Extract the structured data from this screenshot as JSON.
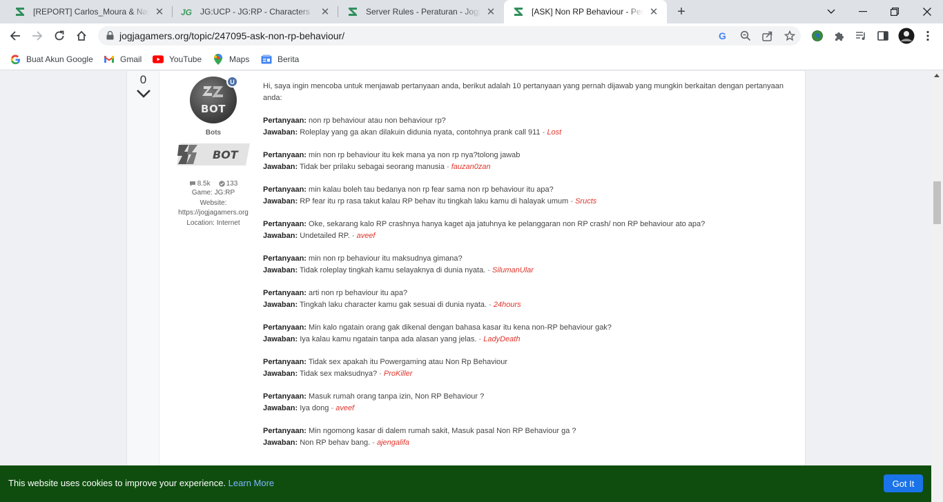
{
  "tabs": [
    {
      "title": "[REPORT] Carlos_Moura & Nayla_",
      "favicon": "jg-logo-icon",
      "active": false
    },
    {
      "title": "JG:UCP - JG:RP - Characters",
      "favicon": "jg-italic-icon",
      "active": false
    },
    {
      "title": "Server Rules - Peraturan - Jogjag",
      "favicon": "jg-logo-icon",
      "active": false
    },
    {
      "title": "[ASK] Non RP Behaviour - Pertan",
      "favicon": "jg-logo-icon",
      "active": true
    }
  ],
  "toolbar": {
    "url": "jogjagamers.org/topic/247095-ask-non-rp-behaviour/"
  },
  "bookmarks": [
    {
      "label": "Buat Akun Google",
      "icon": "google-icon"
    },
    {
      "label": "Gmail",
      "icon": "gmail-icon"
    },
    {
      "label": "YouTube",
      "icon": "youtube-icon"
    },
    {
      "label": "Maps",
      "icon": "maps-icon"
    },
    {
      "label": "Berita",
      "icon": "news-icon"
    }
  ],
  "post": {
    "vote_count": "0",
    "author": {
      "avatar_text": "BOT",
      "badge_letter": "U",
      "group": "Bots",
      "group_badge_text": "BOT",
      "posts": "8.5k",
      "reputation": "133",
      "game": "Game: JG:RP",
      "website_label": "Website:",
      "website": "https://jogjagamers.org",
      "location": "Location: Internet"
    },
    "intro": "Hi, saya ingin mencoba untuk menjawab pertanyaan anda, berikut adalah 10 pertanyaan yang pernah dijawab yang mungkin berkaitan dengan pertanyaan anda:",
    "q_label": "Pertanyaan:",
    "a_label": "Jawaban:",
    "qa": [
      {
        "q": "non rp behaviour atau non behaviour rp?",
        "a": "Roleplay yang ga akan dilakuin didunia nyata, contohnya prank call 911",
        "by": "Lost"
      },
      {
        "q": "min non rp behaviour itu kek mana ya non rp nya?tolong jawab",
        "a": "Tidak ber prilaku sebagai seorang manusia",
        "by": "fauzan0zan"
      },
      {
        "q": "min kalau boleh tau bedanya non rp fear sama non rp behaviour itu apa?",
        "a": "RP fear itu rp rasa takut kalau RP behav itu tingkah laku kamu di halayak umum",
        "by": "Sructs"
      },
      {
        "q": "Oke, sekarang kalo RP crashnya hanya kaget aja jatuhnya ke pelanggaran non RP crash/ non RP behaviour ato apa?",
        "a": "Undetailed RP.",
        "by": "aveef"
      },
      {
        "q": "min non rp behaviour itu maksudnya gimana?",
        "a": "Tidak roleplay tingkah kamu selayaknya di dunia nyata.",
        "by": "SilumanUlar"
      },
      {
        "q": "arti non rp behaviour itu apa?",
        "a": "Tingkah laku character kamu gak sesuai di dunia nyata.",
        "by": "24hours"
      },
      {
        "q": "Min kalo ngatain orang gak dikenal dengan bahasa kasar itu kena non-RP behaviour gak?",
        "a": "Iya kalau kamu ngatain tanpa ada alasan yang jelas.",
        "by": "LadyDeath"
      },
      {
        "q": "Tidak sex apakah itu Powergaming atau Non Rp Behaviour",
        "a": "Tidak sex maksudnya?",
        "by": "ProKiller"
      },
      {
        "q": "Masuk rumah orang tanpa izin, Non RP Behaviour ?",
        "a": "Iya dong",
        "by": "aveef"
      },
      {
        "q": "Min ngomong kasar di dalem rumah sakit, Masuk pasal Non RP Behaviour ga ?",
        "a": "Non RP behav bang.",
        "by": "ajengalifa"
      }
    ]
  },
  "cookie": {
    "message": "This website uses cookies to improve your experience.",
    "learn_more": "Learn More",
    "button": "Got It"
  },
  "colors": {
    "cookie_bg": "#0f4d0f",
    "link_red": "#e0342b",
    "button_blue": "#1a73e8"
  }
}
